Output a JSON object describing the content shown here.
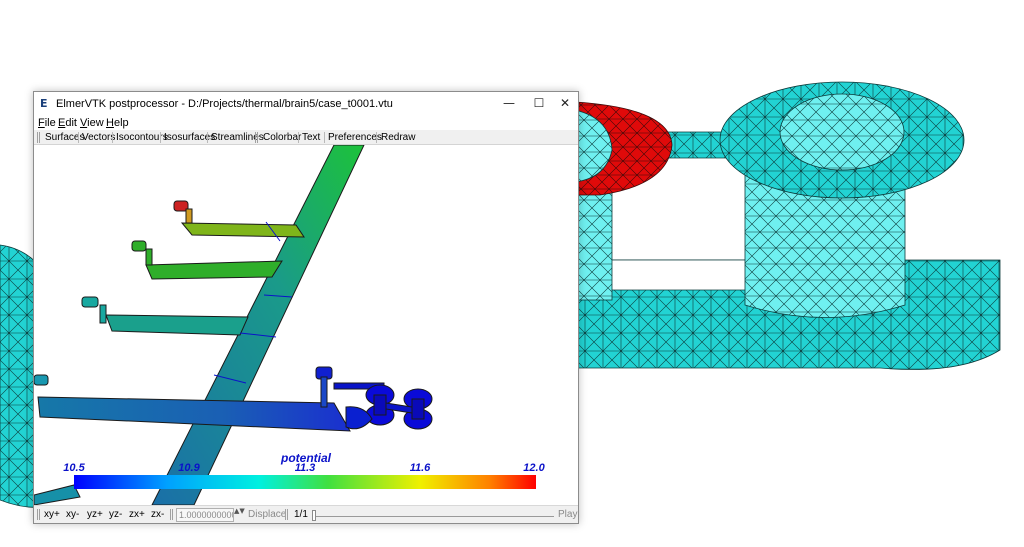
{
  "window": {
    "title": "ElmerVTK postprocessor - D:/Projects/thermal/brain5/case_t0001.vtu",
    "icon": "E",
    "controls": {
      "minimize": "—",
      "maximize": "☐",
      "close": "✕"
    }
  },
  "menu": [
    "File",
    "Edit",
    "View",
    "Help"
  ],
  "toolbar": {
    "group1": [
      "Surfaces",
      "Vectors",
      "Isocontours",
      "Isosurfaces",
      "Streamlines"
    ],
    "group2": [
      "Colorbar",
      "Text",
      "Preferences",
      "Redraw"
    ]
  },
  "colorbar": {
    "title": "potential",
    "labels": [
      "10.5",
      "10.9",
      "11.3",
      "11.6",
      "12.0"
    ],
    "min": 10.5,
    "max": 12.0
  },
  "statusbar": {
    "views": [
      "xy+",
      "xy-",
      "yz+",
      "yz-",
      "zx+",
      "zx-"
    ],
    "scale_value": "1.0000000000",
    "spin": "▲▼",
    "displace_label": "Displace",
    "frame": "1/1",
    "frame_fraction": 0,
    "play_label": "Play"
  },
  "colors": {
    "mesh_cyan": "#22d3d3",
    "mesh_red": "#e00a0a",
    "colorbar_text": "#0b12c9"
  }
}
